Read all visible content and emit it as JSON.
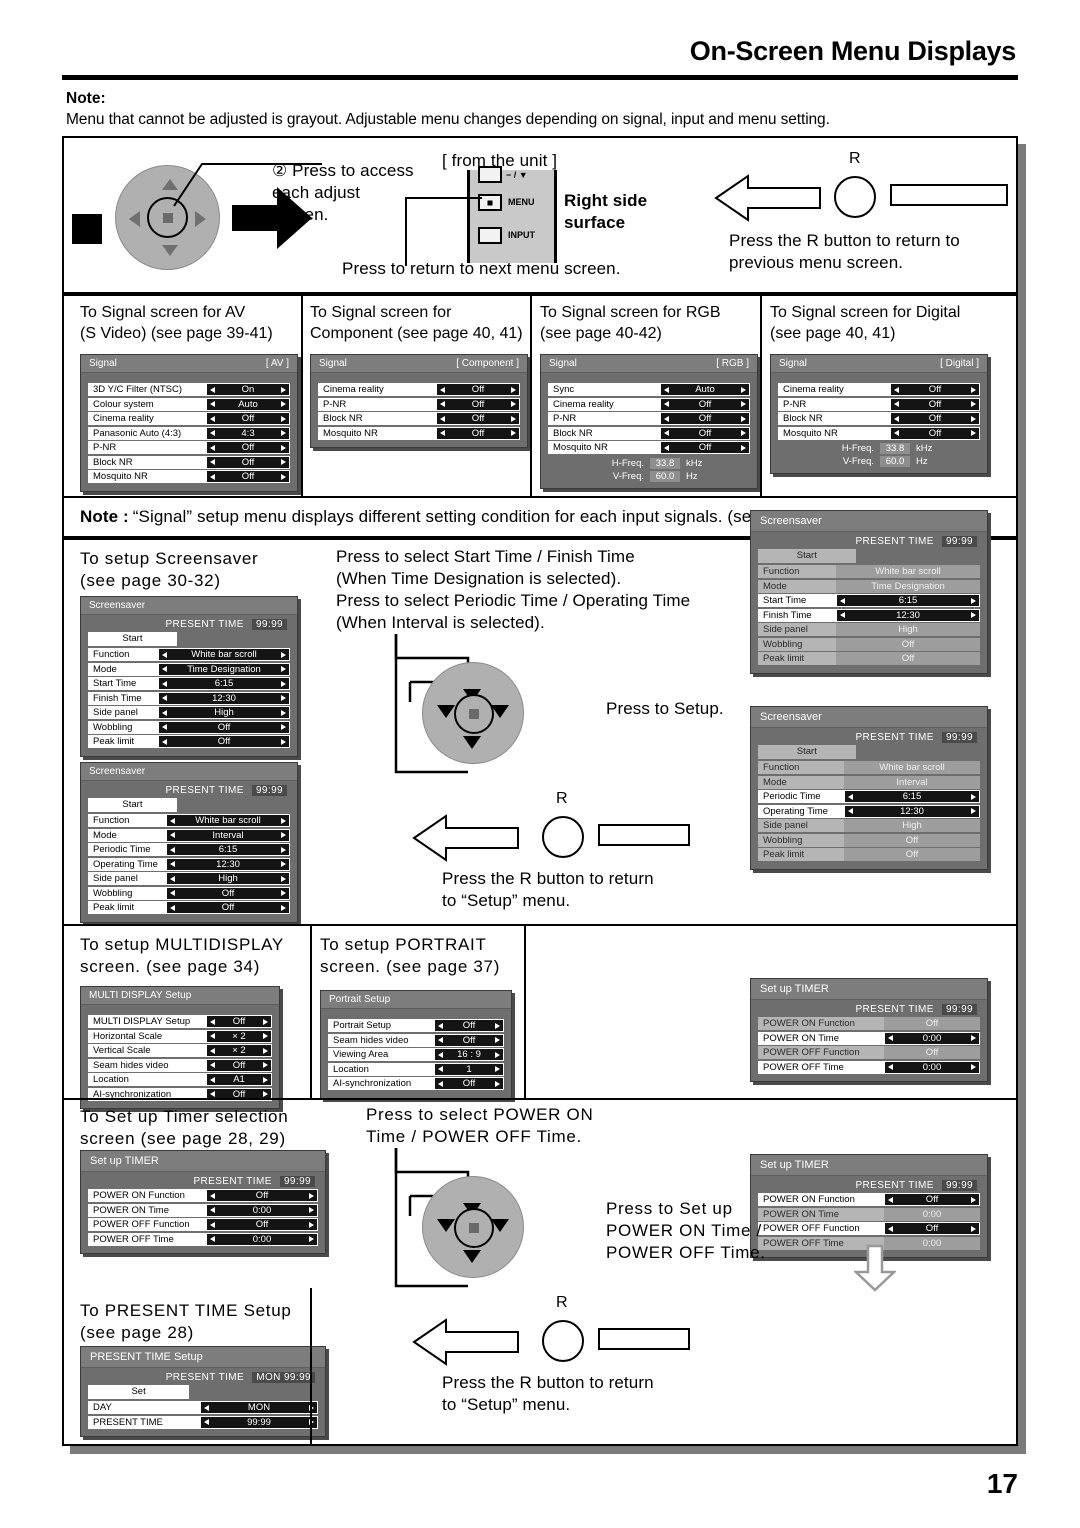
{
  "header": {
    "title": "On-Screen Menu Displays",
    "note_label": "Note:",
    "note_text": "Menu that cannot be adjusted is grayout. Adjustable menu changes depending on signal, input and menu setting."
  },
  "page_number": "17",
  "top_diagram": {
    "step_text_line1": "② Press to access",
    "step_text_line2": "each adjust",
    "step_text_line3": "screen.",
    "from_unit_label": "[ from the unit ]",
    "right_side_line1": "Right side",
    "right_side_line2": "surface",
    "unit_buttons": [
      "− / ▼",
      "MENU",
      "INPUT"
    ],
    "return_next_text": "Press to return to next menu screen.",
    "r_label": "R",
    "r_text_line1": "Press the R button to return to",
    "r_text_line2": "previous menu screen."
  },
  "signal_section": {
    "captions": [
      {
        "l1": "To Signal screen for AV",
        "l2": "(S Video) (see page 39-41)"
      },
      {
        "l1": "To Signal screen for",
        "l2": "Component (see page 40, 41)"
      },
      {
        "l1": "To Signal screen for RGB",
        "l2": "(see page 40-42)"
      },
      {
        "l1": "To Signal screen for Digital",
        "l2": "(see page 40, 41)"
      }
    ],
    "panels": [
      {
        "title": "Signal",
        "tag": "[ AV ]",
        "rows": [
          {
            "label": "3D Y/C Filter (NTSC)",
            "value": "On"
          },
          {
            "label": "Colour system",
            "value": "Auto"
          },
          {
            "label": "Cinema reality",
            "value": "Off"
          },
          {
            "label": "Panasonic Auto (4:3)",
            "value": "4:3"
          },
          {
            "label": "P-NR",
            "value": "Off"
          },
          {
            "label": "Block NR",
            "value": "Off"
          },
          {
            "label": "Mosquito NR",
            "value": "Off"
          }
        ],
        "freq": []
      },
      {
        "title": "Signal",
        "tag": "[ Component ]",
        "rows": [
          {
            "label": "Cinema reality",
            "value": "Off"
          },
          {
            "label": "P-NR",
            "value": "Off"
          },
          {
            "label": "Block NR",
            "value": "Off"
          },
          {
            "label": "Mosquito NR",
            "value": "Off"
          }
        ],
        "freq": []
      },
      {
        "title": "Signal",
        "tag": "[ RGB ]",
        "rows": [
          {
            "label": "Sync",
            "value": "Auto"
          },
          {
            "label": "Cinema reality",
            "value": "Off"
          },
          {
            "label": "P-NR",
            "value": "Off"
          },
          {
            "label": "Block NR",
            "value": "Off"
          },
          {
            "label": "Mosquito NR",
            "value": "Off"
          }
        ],
        "freq": [
          {
            "label": "H-Freq.",
            "value": "33.8",
            "unit": "kHz"
          },
          {
            "label": "V-Freq.",
            "value": "60.0",
            "unit": "Hz"
          }
        ]
      },
      {
        "title": "Signal",
        "tag": "[ Digital ]",
        "rows": [
          {
            "label": "Cinema reality",
            "value": "Off"
          },
          {
            "label": "P-NR",
            "value": "Off"
          },
          {
            "label": "Block NR",
            "value": "Off"
          },
          {
            "label": "Mosquito NR",
            "value": "Off"
          }
        ],
        "freq": [
          {
            "label": "H-Freq.",
            "value": "33.8",
            "unit": "kHz"
          },
          {
            "label": "V-Freq.",
            "value": "60.0",
            "unit": "Hz"
          }
        ]
      }
    ],
    "note2_label": "Note :",
    "note2_text": "“Signal” setup menu displays different setting condition for each input signals. (see page 13)"
  },
  "screensaver_section": {
    "caption_l1": "To setup Screensaver",
    "caption_l2": "(see page 30-32)",
    "instr_l1": "Press to select Start Time / Finish Time",
    "instr_l2": "(When Time Designation is selected).",
    "instr_l3": "Press to select Periodic Time / Operating Time",
    "instr_l4": "(When Interval is selected).",
    "press_setup": "Press to Setup.",
    "r_label": "R",
    "r_text_l1": "Press the R button to return",
    "r_text_l2": "to “Setup” menu.",
    "present_time_label": "PRESENT  TIME",
    "present_time_value": "99:99",
    "start_button": "Start",
    "panel_time_designation": {
      "title": "Screensaver",
      "rows": [
        {
          "label": "Function",
          "value": "White bar scroll",
          "gray": false
        },
        {
          "label": "Mode",
          "value": "Time Designation",
          "gray": false
        },
        {
          "label": "Start Time",
          "value": "6:15",
          "gray": false
        },
        {
          "label": "Finish Time",
          "value": "12:30",
          "gray": false
        },
        {
          "label": "Side panel",
          "value": "High",
          "gray": false
        },
        {
          "label": "Wobbling",
          "value": "Off",
          "gray": false
        },
        {
          "label": "Peak limit",
          "value": "Off",
          "gray": false
        }
      ]
    },
    "panel_interval": {
      "title": "Screensaver",
      "rows": [
        {
          "label": "Function",
          "value": "White bar scroll",
          "gray": false
        },
        {
          "label": "Mode",
          "value": "Interval",
          "gray": false
        },
        {
          "label": "Periodic Time",
          "value": "6:15",
          "gray": false
        },
        {
          "label": "Operating Time",
          "value": "12:30",
          "gray": false
        },
        {
          "label": "Side panel",
          "value": "High",
          "gray": false
        },
        {
          "label": "Wobbling",
          "value": "Off",
          "gray": false
        },
        {
          "label": "Peak limit",
          "value": "Off",
          "gray": false
        }
      ]
    },
    "panel_td_selected": {
      "title": "Screensaver",
      "rows": [
        {
          "label": "Function",
          "value": "White bar scroll",
          "gray": true
        },
        {
          "label": "Mode",
          "value": "Time Designation",
          "gray": true
        },
        {
          "label": "Start Time",
          "value": "6:15",
          "gray": false
        },
        {
          "label": "Finish Time",
          "value": "12:30",
          "gray": false
        },
        {
          "label": "Side panel",
          "value": "High",
          "gray": true
        },
        {
          "label": "Wobbling",
          "value": "Off",
          "gray": true
        },
        {
          "label": "Peak limit",
          "value": "Off",
          "gray": true
        }
      ]
    },
    "panel_iv_selected": {
      "title": "Screensaver",
      "rows": [
        {
          "label": "Function",
          "value": "White bar scroll",
          "gray": true
        },
        {
          "label": "Mode",
          "value": "Interval",
          "gray": true
        },
        {
          "label": "Periodic Time",
          "value": "6:15",
          "gray": false
        },
        {
          "label": "Operating Time",
          "value": "12:30",
          "gray": false
        },
        {
          "label": "Side panel",
          "value": "High",
          "gray": true
        },
        {
          "label": "Wobbling",
          "value": "Off",
          "gray": true
        },
        {
          "label": "Peak limit",
          "value": "Off",
          "gray": true
        }
      ]
    }
  },
  "multidisplay_section": {
    "caption_l1": "To setup MULTIDISPLAY",
    "caption_l2": "screen. (see page 34)",
    "panel": {
      "title": "MULTI DISPLAY Setup",
      "rows": [
        {
          "label": "MULTI DISPLAY Setup",
          "value": "Off"
        },
        {
          "label": "Horizontal Scale",
          "value": "× 2"
        },
        {
          "label": "Vertical Scale",
          "value": "× 2"
        },
        {
          "label": "Seam hides video",
          "value": "Off"
        },
        {
          "label": "Location",
          "value": "A1"
        },
        {
          "label": "AI-synchronization",
          "value": "Off"
        }
      ]
    }
  },
  "portrait_section": {
    "caption_l1": "To setup PORTRAIT",
    "caption_l2": "screen. (see page 37)",
    "panel": {
      "title": "Portrait Setup",
      "rows": [
        {
          "label": "Portrait Setup",
          "value": "Off"
        },
        {
          "label": "Seam hides video",
          "value": "Off"
        },
        {
          "label": "Viewing Area",
          "value": "16 : 9"
        },
        {
          "label": "Location",
          "value": "1"
        },
        {
          "label": "AI-synchronization",
          "value": "Off"
        }
      ]
    }
  },
  "timer_section": {
    "caption_l1": "To Set up Timer selection",
    "caption_l2": "screen (see page 28, 29)",
    "instr_l1": "Press to select POWER ON",
    "instr_l2": "Time / POWER OFF Time.",
    "setup_l1": "Press to Set up",
    "setup_l2": "POWER ON Time /",
    "setup_l3": "POWER OFF Time.",
    "r_label": "R",
    "r_text_l1": "Press the R button to return",
    "r_text_l2": "to “Setup” menu.",
    "present_time_label": "PRESENT  TIME",
    "present_time_value": "99:99",
    "panel_main": {
      "title": "Set up TIMER",
      "rows": [
        {
          "label": "POWER ON Function",
          "value": "Off",
          "gray": false
        },
        {
          "label": "POWER ON Time",
          "value": "0:00",
          "gray": false
        },
        {
          "label": "POWER OFF Function",
          "value": "Off",
          "gray": false
        },
        {
          "label": "POWER OFF Time",
          "value": "0:00",
          "gray": false
        }
      ]
    },
    "panel_time_sel": {
      "title": "Set up TIMER",
      "rows": [
        {
          "label": "POWER ON Function",
          "value": "Off",
          "gray": true
        },
        {
          "label": "POWER ON Time",
          "value": "0:00",
          "gray": false
        },
        {
          "label": "POWER OFF Function",
          "value": "Off",
          "gray": true
        },
        {
          "label": "POWER OFF Time",
          "value": "0:00",
          "gray": false
        }
      ]
    },
    "panel_func_sel": {
      "title": "Set up TIMER",
      "rows": [
        {
          "label": "POWER ON Function",
          "value": "Off",
          "gray": false
        },
        {
          "label": "POWER ON Time",
          "value": "0:00",
          "gray": true
        },
        {
          "label": "POWER OFF Function",
          "value": "Off",
          "gray": false
        },
        {
          "label": "POWER OFF Time",
          "value": "0:00",
          "gray": true
        }
      ]
    }
  },
  "present_time_section": {
    "caption_l1": "To PRESENT TIME Setup",
    "caption_l2": "(see page 28)",
    "panel": {
      "title": "PRESENT  TIME Setup",
      "present_time_label": "PRESENT  TIME",
      "present_time_value": "MON  99:99",
      "set_button": "Set",
      "rows": [
        {
          "label": "DAY",
          "value": "MON"
        },
        {
          "label": "PRESENT  TIME",
          "value": "99:99"
        }
      ]
    }
  }
}
